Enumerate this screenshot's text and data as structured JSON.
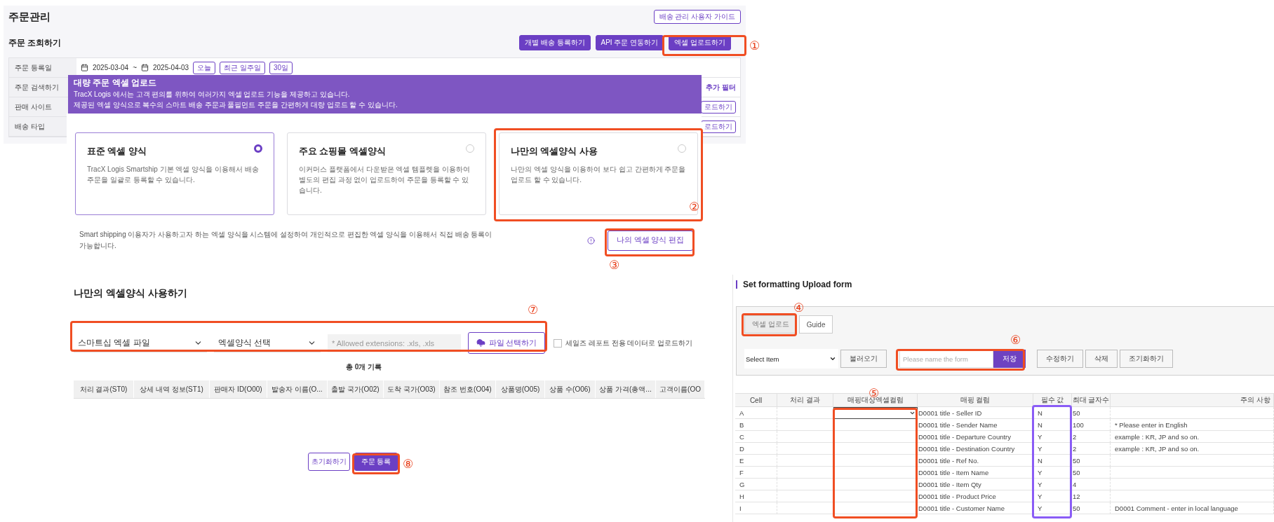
{
  "order_page": {
    "title": "주문관리",
    "guide_button": "배송 관리 사용자 가이드",
    "section_title": "주문 조회하기",
    "actions": [
      {
        "label": "개별 배송 등록하기"
      },
      {
        "label": "API 주문 연동하기"
      },
      {
        "label": "엑셀 업로드하기"
      }
    ],
    "filters": [
      {
        "label": "주문 등록일"
      },
      {
        "label": "주문 검색하기"
      },
      {
        "label": "판매 사이트"
      },
      {
        "label": "배송 타입"
      }
    ],
    "date_from": "2025-03-04",
    "date_separator": "~",
    "date_to": "2025-04-03",
    "quick_ranges": [
      "오늘",
      "최근 일주일",
      "30일"
    ],
    "extra_filter": "추가 필터",
    "row_buttons": [
      "로드하기",
      "로드하기"
    ]
  },
  "banner": {
    "title": "대량 주문 엑셀 업로드",
    "lines": [
      "TracX Logis 에서는 고객 편의를 위하여 여러가지 엑셀 업로드 기능을 제공하고 있습니다.",
      "제공된 엑셀 양식으로 복수의 스마트 배송 주문과 풀필먼트 주문을 간편하게 대량 업로드 할 수 있습니다."
    ]
  },
  "format_cards": [
    {
      "title": "표준 엑셀 양식",
      "description": "TracX Logis Smartship 기본 엑셀 양식을 이용해서 배송 주문을 일괄로 등록할 수 있습니다.",
      "selected": true
    },
    {
      "title": "주요 쇼핑몰 엑셀양식",
      "description": "이커머스 플랫폼에서 다운받은 엑셀 템플렛을 이용하여 별도의 편집 과정 없이 업로드하여 주문을 등록할 수 있습니다.",
      "selected": false
    },
    {
      "title": "나만의 엑셀양식 사용",
      "description": "나만의 엑셀 양식을 이용하여 보다 쉽고 간편하게 주문을 업로드 할 수 있습니다.",
      "selected": false
    }
  ],
  "note": "Smart shipping 이용자가 사용하고자 하는 엑셀 양식을 시스템에 설정하여 개인적으로 편집한 엑셀 양식을 이용해서 직접 배송 등록이 가능합니다.",
  "edit_button": "나의 엑셀 양식 편집",
  "my_format": {
    "title": "나만의 엑셀양식 사용하기",
    "file_type": "스마트십 엑셀 파일",
    "format_select": "엑셀양식 선택",
    "file_placeholder": "* Allowed extensions: .xls, .xls",
    "file_button": "파일 선택하기",
    "report_checkbox": {
      "label": "세일즈 레포트 전용 데이터로 업로드하기",
      "checked": false
    },
    "record_count": "총 0개 기록",
    "columns": [
      "처리 결과(ST0)",
      "상세 내역 정보(ST1)",
      "판매자 ID(O00)",
      "발송자 이름(O...",
      "출발 국가(O02)",
      "도착 국가(O03)",
      "참조 번호(O04)",
      "상품명(O05)",
      "상품 수(O06)",
      "상품 가격(총액...",
      "고객이름(OO"
    ],
    "buttons": [
      {
        "label": "초기화하기",
        "kind": "outline"
      },
      {
        "label": "주문 등록",
        "kind": "primary"
      }
    ]
  },
  "format_form": {
    "title": "Set formatting Upload form",
    "tabs": [
      {
        "label": "엑셀 업로드",
        "selected": true
      },
      {
        "label": "Guide",
        "selected": false
      }
    ],
    "item_select": "Select Item",
    "load_button": "불러오기",
    "name_placeholder": "Please name the form",
    "save_button": "저장",
    "buttons": [
      "수정하기",
      "삭제",
      "조기화하기"
    ],
    "columns": [
      "Cell",
      "처리 결과",
      "매핑대상엑셀컬럼",
      "매핑 컬럼",
      "필수 값",
      "최대 글자수",
      "주의 사항"
    ],
    "rows": [
      {
        "cell": "A",
        "dropdown": true,
        "mapping": "D0001 title - Seller ID",
        "required": "N",
        "max": "50"
      },
      {
        "cell": "B",
        "dropdown": false,
        "mapping": "D0001 title - Sender Name",
        "required": "N",
        "max": "100",
        "note": "* Please enter in English"
      },
      {
        "cell": "C",
        "dropdown": false,
        "mapping": "D0001 title - Departure Country",
        "required": "Y",
        "max": "2",
        "note": "example : KR, JP and so on."
      },
      {
        "cell": "D",
        "dropdown": false,
        "mapping": "D0001 title - Destination Country",
        "required": "Y",
        "max": "2",
        "note": "example : KR, JP and so on."
      },
      {
        "cell": "E",
        "dropdown": false,
        "mapping": "D0001 title - Ref No.",
        "required": "N",
        "max": "50"
      },
      {
        "cell": "F",
        "dropdown": false,
        "mapping": "D0001 title - Item Name",
        "required": "Y",
        "max": "50"
      },
      {
        "cell": "G",
        "dropdown": false,
        "mapping": "D0001 title - Item Qty",
        "required": "Y",
        "max": "4"
      },
      {
        "cell": "H",
        "dropdown": false,
        "mapping": "D0001 title - Product Price",
        "required": "Y",
        "max": "12"
      },
      {
        "cell": "I",
        "dropdown": false,
        "mapping": "D0001 title - Customer Name",
        "required": "Y",
        "max": "50",
        "note": "D0001 Comment - enter in local language"
      }
    ]
  },
  "callouts": [
    {
      "label": "①"
    },
    {
      "label": "②"
    },
    {
      "label": "③"
    },
    {
      "label": "④"
    },
    {
      "label": "⑤"
    },
    {
      "label": "⑥"
    },
    {
      "label": "⑦"
    },
    {
      "label": "⑧"
    }
  ],
  "highlights": [
    {
      "color": "#f04e23"
    },
    {
      "color": "#f04e23"
    },
    {
      "color": "#f04e23"
    },
    {
      "color": "#f04e23"
    },
    {
      "color": "#f04e23"
    },
    {
      "color": "#f04e23"
    },
    {
      "color": "#f04e23"
    },
    {
      "color": "#f04e23"
    },
    {
      "color": "#8a5cf6"
    }
  ]
}
